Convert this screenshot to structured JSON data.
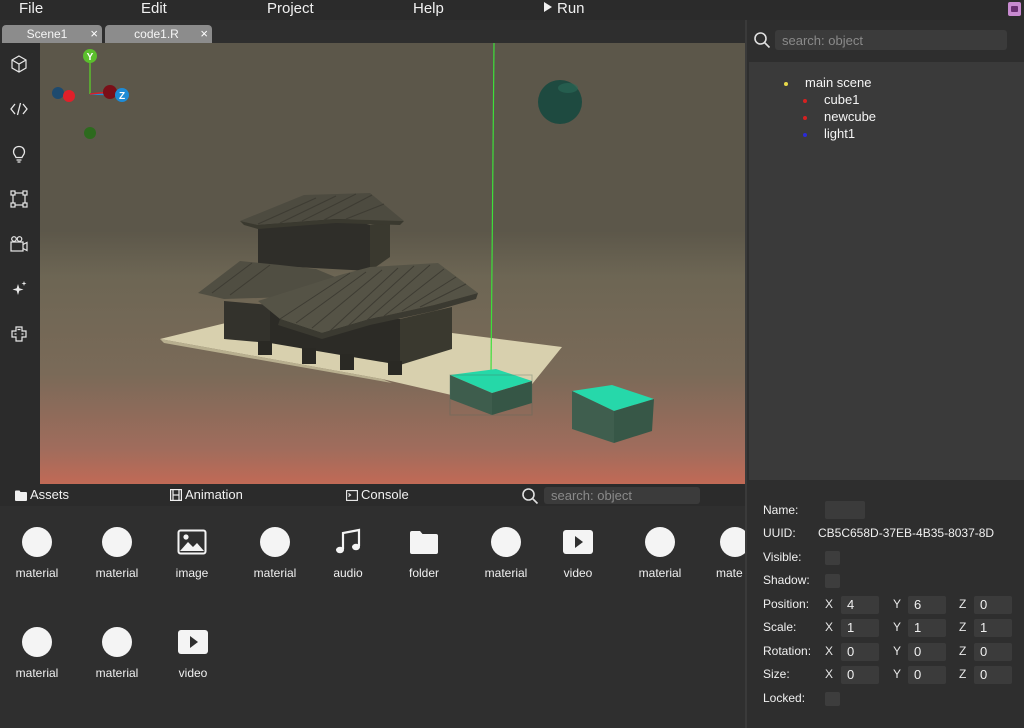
{
  "menu": {
    "file": "File",
    "edit": "Edit",
    "project": "Project",
    "help": "Help",
    "run": "Run"
  },
  "tabs": [
    {
      "label": "Scene1",
      "close": "×"
    },
    {
      "label": "code1.R",
      "close": "×"
    }
  ],
  "left_tools": [
    "cube-icon",
    "code-icon",
    "lightbulb-icon",
    "bounding-box-icon",
    "camera-icon",
    "sparkles-icon",
    "puzzle-icon"
  ],
  "viewport": {
    "gizmo": {
      "y_label": "Y",
      "z_label": "Z",
      "y_color": "#5bbf2d",
      "z_color": "#1e8bd6",
      "x_color": "#d61f2a"
    }
  },
  "right_panel": {
    "search_placeholder": "search: object",
    "tree": [
      {
        "label": "main scene",
        "color": "#e6d84a"
      },
      {
        "label": "cube1",
        "color": "#d62020"
      },
      {
        "label": "newcube",
        "color": "#d62020"
      },
      {
        "label": "light1",
        "color": "#2a2ad6"
      }
    ]
  },
  "properties": {
    "name_label": "Name:",
    "name_value": "",
    "uuid_label": "UUID:",
    "uuid_value": "CB5C658D-37EB-4B35-8037-8D",
    "visible_label": "Visible:",
    "shadow_label": "Shadow:",
    "position": {
      "label": "Position:",
      "x": "4",
      "y": "6",
      "z": "0"
    },
    "scale": {
      "label": "Scale:",
      "x": "1",
      "y": "1",
      "z": "1"
    },
    "rotation": {
      "label": "Rotation:",
      "x": "0",
      "y": "0",
      "z": "0"
    },
    "size": {
      "label": "Size:",
      "x": "0",
      "y": "0",
      "z": "0"
    },
    "locked_label": "Locked:",
    "axis_x": "X",
    "axis_y": "Y",
    "axis_z": "Z"
  },
  "bottom_tabs": {
    "assets": "Assets",
    "animation": "Animation",
    "console": "Console",
    "search_placeholder": "search: object"
  },
  "assets": [
    {
      "label": "material",
      "icon": "material-circle"
    },
    {
      "label": "material",
      "icon": "material-circle"
    },
    {
      "label": "image",
      "icon": "image-icon"
    },
    {
      "label": "material",
      "icon": "material-circle"
    },
    {
      "label": "audio",
      "icon": "music-note-icon"
    },
    {
      "label": "folder",
      "icon": "folder-icon"
    },
    {
      "label": "material",
      "icon": "material-circle"
    },
    {
      "label": "video",
      "icon": "video-play-icon"
    },
    {
      "label": "material",
      "icon": "material-circle"
    },
    {
      "label": "mate",
      "icon": "material-circle"
    },
    {
      "label": "material",
      "icon": "material-circle"
    },
    {
      "label": "material",
      "icon": "material-circle"
    },
    {
      "label": "video",
      "icon": "video-play-icon"
    }
  ]
}
